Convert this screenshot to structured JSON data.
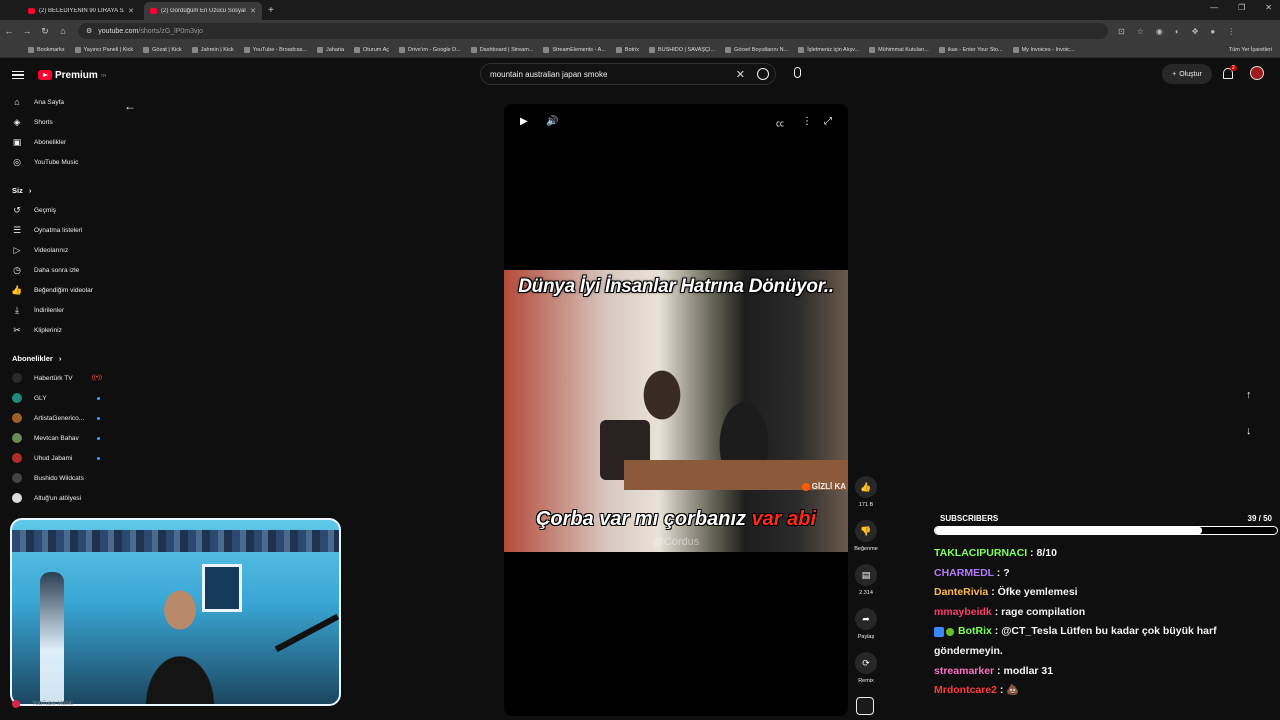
{
  "browser": {
    "tabs": [
      {
        "title": "(2) BELEDİYENİN 90 LİRAYA SAT...",
        "active": false
      },
      {
        "title": "(2) Gördüğüm En Üzücü Sosyal...",
        "active": true
      }
    ],
    "new_tab": "+",
    "url_host": "youtube.com",
    "url_path": "/shorts/zG_lP0m3vjo",
    "bookmarks": [
      "Bookmarks",
      "Yayıncı Paneli | Kick",
      "Gözat | Kick",
      "Jahrein | Kick",
      "YouTube - Broadcas...",
      "Jaharia",
      "Oturum Aç",
      "Drive'ım - Google D...",
      "Dashboard | Stream...",
      "StreamElements - A...",
      "Botrix",
      "BUSHIDO | SAVAŞÇI...",
      "Görsel Boyutlarını N...",
      "İşletmeniz için Alışv...",
      "Mühimmat Kutuları...",
      "ikas - Enter Your Sto...",
      "My Invoices - Invoic..."
    ],
    "all_bookmarks": "Tüm Yer İşaretleri"
  },
  "header": {
    "logo_text": "Premium",
    "logo_sup": "TR",
    "search_value": "mountain australian japan smoke",
    "create_label": "Oluştur",
    "notif_count": "2"
  },
  "sidebar": {
    "main": [
      {
        "label": "Ana Sayfa",
        "icon": "home-icon",
        "glyph": "⌂"
      },
      {
        "label": "Shorts",
        "icon": "shorts-icon",
        "glyph": "◈"
      },
      {
        "label": "Abonelikler",
        "icon": "subscriptions-icon",
        "glyph": "▣"
      },
      {
        "label": "YouTube Music",
        "icon": "music-icon",
        "glyph": "◎"
      }
    ],
    "you_heading": "Siz",
    "you": [
      {
        "label": "Geçmiş",
        "icon": "history-icon",
        "glyph": "↺"
      },
      {
        "label": "Oynatma listeleri",
        "icon": "playlists-icon",
        "glyph": "☰"
      },
      {
        "label": "Videolarınız",
        "icon": "your-videos-icon",
        "glyph": "▷"
      },
      {
        "label": "Daha sonra izle",
        "icon": "watch-later-icon",
        "glyph": "◷"
      },
      {
        "label": "Beğendiğim videolar",
        "icon": "liked-icon",
        "glyph": "👍"
      },
      {
        "label": "İndirilenler",
        "icon": "downloads-icon",
        "glyph": "⤓"
      },
      {
        "label": "Klipleriniz",
        "icon": "clips-icon",
        "glyph": "✂"
      }
    ],
    "subs_heading": "Abonelikler",
    "channels": [
      {
        "label": "Habertürk TV",
        "color": "#2a2a2a",
        "marker": "live"
      },
      {
        "label": "GLY",
        "color": "#1f8a7a",
        "marker": "dot"
      },
      {
        "label": "ArtistaGenerico...",
        "color": "#a0602a",
        "marker": "dot"
      },
      {
        "label": "Mevtcan Bahav",
        "color": "#6a8a5a",
        "marker": "dot"
      },
      {
        "label": "Uhud Jabami",
        "color": "#b32a2a",
        "marker": "dot"
      },
      {
        "label": "Bushido Wildcats",
        "color": "#444444",
        "marker": "none"
      },
      {
        "label": "Altuğ'un atölyesi",
        "color": "#dddddd",
        "marker": "none"
      }
    ],
    "bottom_item": "YouTube Music"
  },
  "video": {
    "caption_top": "Dünya İyi İnsanlar Hatrına Dönüyor..",
    "caption_bottom_main": "Çorba var mı çorbanız",
    "caption_bottom_red": "var abi",
    "watermark": "@Cordus",
    "channel_bug": "GİZLİ KA"
  },
  "actions": [
    {
      "name": "like-button",
      "icon": "like-icon",
      "glyph": "👍",
      "label": "171 B"
    },
    {
      "name": "dislike-button",
      "icon": "dislike-icon",
      "glyph": "👎",
      "label": "Beğenme"
    },
    {
      "name": "comments-button",
      "icon": "comment-icon",
      "glyph": "▤",
      "label": "2.314"
    },
    {
      "name": "share-button",
      "icon": "share-icon",
      "glyph": "➦",
      "label": "Paylaş"
    },
    {
      "name": "remix-button",
      "icon": "remix-icon",
      "glyph": "⟳",
      "label": "Remix"
    }
  ],
  "subscribers": {
    "label": "SUBSCRIBERS",
    "current": 39,
    "goal": 50,
    "count_text": "39 / 50"
  },
  "chat": [
    {
      "user": "TAKLACIPURNACI",
      "color": "#7dff5a",
      "text": "8/10"
    },
    {
      "user": "CHARMEDL",
      "color": "#b47bff",
      "text": "?"
    },
    {
      "user": "DanteRivia",
      "color": "#ffb84d",
      "text": "Öfke yemlemesi"
    },
    {
      "user": "mmaybeidk",
      "color": "#ff3b6a",
      "text": "rage compilation"
    },
    {
      "user": "BotRix",
      "color": "#7dff5a",
      "text": "@CT_Tesla Lütfen bu kadar çok büyük harf göndermeyin.",
      "bot": true
    },
    {
      "user": "streamarker",
      "color": "#ff6ec7",
      "text": "modlar 31"
    },
    {
      "user": "Mrdontcare2",
      "color": "#ff3b3b",
      "text": "💩"
    }
  ]
}
